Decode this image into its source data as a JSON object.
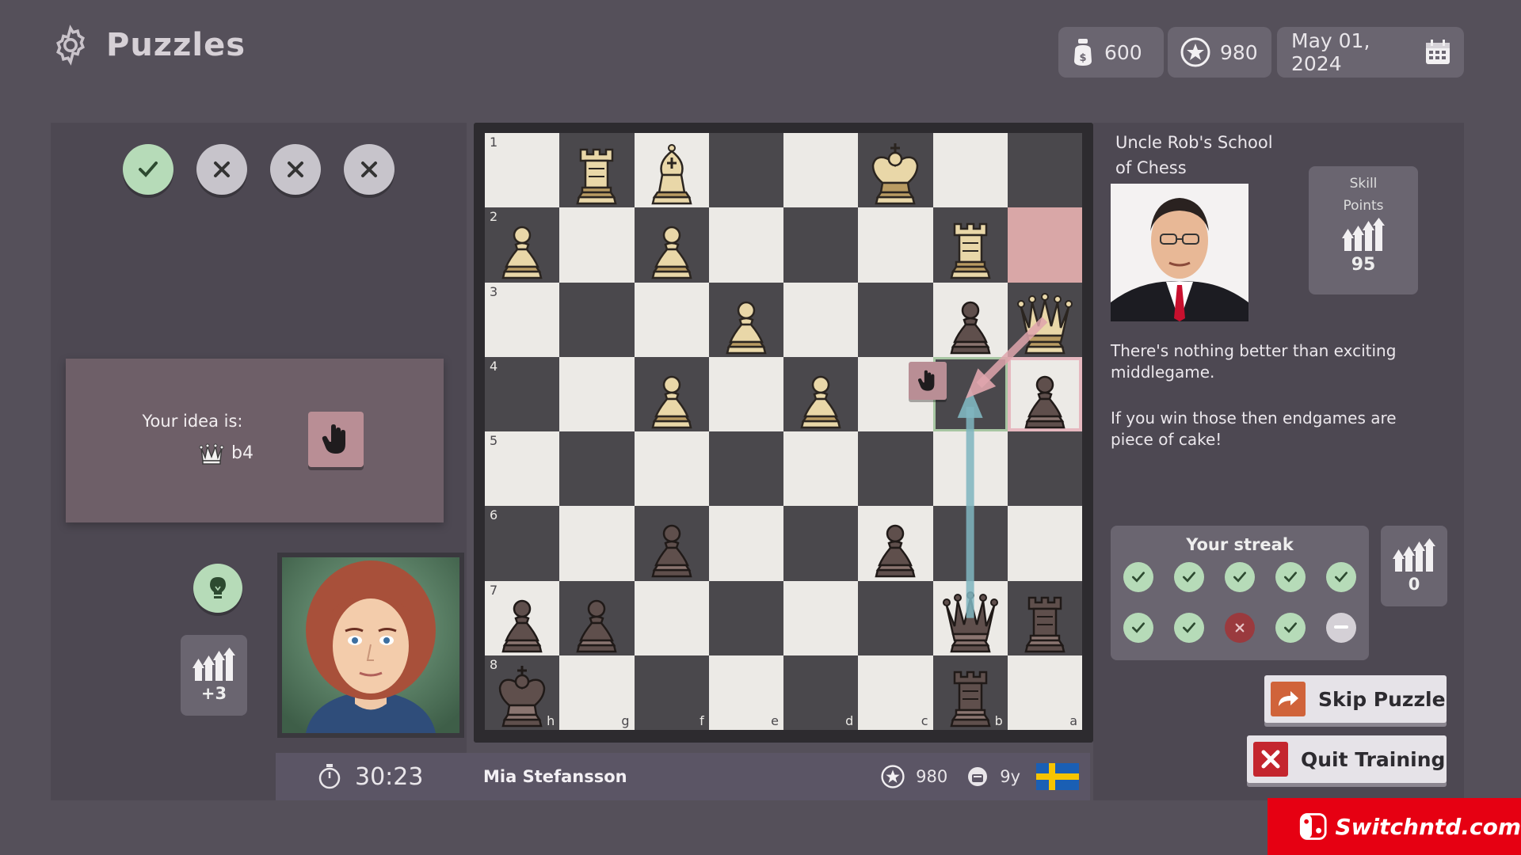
{
  "header": {
    "title": "Puzzles",
    "coins": "600",
    "rating": "980",
    "date": "May 01, 2024"
  },
  "attempts": [
    "correct",
    "wrong",
    "wrong",
    "wrong"
  ],
  "idea": {
    "label": "Your idea is:",
    "move": "b4"
  },
  "left_points": "+3",
  "player": {
    "timer": "30:23",
    "name": "Mia Stefansson",
    "rating": "980",
    "age": "9y",
    "flag": "sweden"
  },
  "board": {
    "ranks": [
      "1",
      "2",
      "3",
      "4",
      "5",
      "6",
      "7",
      "8"
    ],
    "files": [
      "h",
      "g",
      "f",
      "e",
      "d",
      "c",
      "b",
      "a"
    ],
    "pieces": [
      {
        "square": "g1",
        "piece": "rook",
        "color": "white"
      },
      {
        "square": "f1",
        "piece": "bishop",
        "color": "white"
      },
      {
        "square": "c1",
        "piece": "king",
        "color": "white"
      },
      {
        "square": "h2",
        "piece": "pawn",
        "color": "white"
      },
      {
        "square": "f2",
        "piece": "pawn",
        "color": "white"
      },
      {
        "square": "b2",
        "piece": "rook",
        "color": "white"
      },
      {
        "square": "e3",
        "piece": "pawn",
        "color": "white"
      },
      {
        "square": "b3",
        "piece": "pawn",
        "color": "black"
      },
      {
        "square": "a3",
        "piece": "queen",
        "color": "white"
      },
      {
        "square": "f4",
        "piece": "pawn",
        "color": "white"
      },
      {
        "square": "d4",
        "piece": "pawn",
        "color": "white"
      },
      {
        "square": "a4",
        "piece": "pawn",
        "color": "black"
      },
      {
        "square": "f6",
        "piece": "pawn",
        "color": "black"
      },
      {
        "square": "c6",
        "piece": "pawn",
        "color": "black"
      },
      {
        "square": "h7",
        "piece": "pawn",
        "color": "black"
      },
      {
        "square": "g7",
        "piece": "pawn",
        "color": "black"
      },
      {
        "square": "b7",
        "piece": "queen",
        "color": "black"
      },
      {
        "square": "a7",
        "piece": "rook",
        "color": "black"
      },
      {
        "square": "h8",
        "piece": "king",
        "color": "black"
      },
      {
        "square": "b8",
        "piece": "rook",
        "color": "black"
      }
    ],
    "highlight_from": "a2",
    "highlight_to": "a4"
  },
  "coach": {
    "name": "Uncle Rob's School of Chess",
    "skill_label": "Skill Points",
    "skill_points": "95",
    "message_1": "There's nothing better than exciting middlegame.",
    "message_2": "If you win those then endgames are piece of cake!"
  },
  "streak": {
    "title": "Your streak",
    "results": [
      "correct",
      "correct",
      "correct",
      "correct",
      "correct",
      "correct",
      "correct",
      "wrong",
      "correct",
      "pending"
    ],
    "points": "0"
  },
  "buttons": {
    "skip": "Skip Puzzle",
    "quit": "Quit Training"
  },
  "watermark": "Switchntd.com",
  "colors": {
    "background": "#55505a",
    "panel": "#4d4852",
    "correct": "#b6dbb8",
    "wrong": "#9a3a3e",
    "light_square": "#eceae6",
    "dark_square": "#4a484c"
  }
}
